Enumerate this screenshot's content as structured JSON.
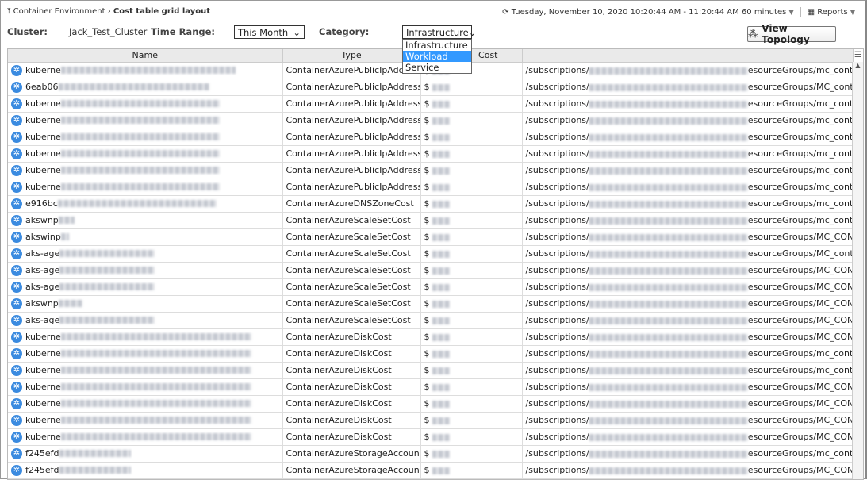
{
  "breadcrumb": {
    "parent": "Container Environment",
    "current": "Cost table grid layout"
  },
  "time_range_display": "Tuesday, November 10, 2020 10:20:44 AM - 11:20:44 AM 60 minutes",
  "reports_label": "Reports",
  "filters": {
    "cluster_label": "Cluster:",
    "cluster_value": "Jack_Test_Cluster",
    "time_label": "Time Range:",
    "time_value": "This Month",
    "category_label": "Category:",
    "category_value": "Infrastructure"
  },
  "category_options": [
    "Infrastructure",
    "Workload",
    "Service"
  ],
  "view_topology_label": "View Topology",
  "columns": [
    "Name",
    "Type",
    "Cost",
    ""
  ],
  "rows": [
    {
      "name": "kuberne",
      "type": "ContainerAzurePublicIpAddressCost",
      "cost": "$",
      "path_a": "/subscriptions/",
      "path_b": "esourceGroups/mc_containera"
    },
    {
      "name": "6eab06",
      "type": "ContainerAzurePublicIpAddressCost",
      "cost": "$",
      "path_a": "/subscriptions/",
      "path_b": "esourceGroups/MC_containera"
    },
    {
      "name": "kuberne",
      "type": "ContainerAzurePublicIpAddressCost",
      "cost": "$",
      "path_a": "/subscriptions/",
      "path_b": "esourceGroups/mc_containera"
    },
    {
      "name": "kuberne",
      "type": "ContainerAzurePublicIpAddressCost",
      "cost": "$",
      "path_a": "/subscriptions/",
      "path_b": "esourceGroups/mc_containera"
    },
    {
      "name": "kuberne",
      "type": "ContainerAzurePublicIpAddressCost",
      "cost": "$",
      "path_a": "/subscriptions/",
      "path_b": "esourceGroups/mc_containera"
    },
    {
      "name": "kuberne",
      "type": "ContainerAzurePublicIpAddressCost",
      "cost": "$",
      "path_a": "/subscriptions/",
      "path_b": "esourceGroups/mc_containera"
    },
    {
      "name": "kuberne",
      "type": "ContainerAzurePublicIpAddressCost",
      "cost": "$",
      "path_a": "/subscriptions/",
      "path_b": "esourceGroups/mc_containera"
    },
    {
      "name": "kuberne",
      "type": "ContainerAzurePublicIpAddressCost",
      "cost": "$",
      "path_a": "/subscriptions/",
      "path_b": "esourceGroups/mc_containera"
    },
    {
      "name": "e916bc",
      "type": "ContainerAzureDNSZoneCost",
      "cost": "$",
      "path_a": "/subscriptions/",
      "path_b": "esourceGroups/mc_containera"
    },
    {
      "name": "akswnp",
      "type": "ContainerAzureScaleSetCost",
      "cost": "$",
      "path_a": "/subscriptions/",
      "path_b": "esourceGroups/mc_containera"
    },
    {
      "name": "akswinp",
      "type": "ContainerAzureScaleSetCost",
      "cost": "$",
      "path_a": "/subscriptions/",
      "path_b": "esourceGroups/MC_CONTAINI"
    },
    {
      "name": "aks-age",
      "type": "ContainerAzureScaleSetCost",
      "cost": "$",
      "path_a": "/subscriptions/",
      "path_b": "esourceGroups/MC_containera"
    },
    {
      "name": "aks-age",
      "type": "ContainerAzureScaleSetCost",
      "cost": "$",
      "path_a": "/subscriptions/",
      "path_b": "esourceGroups/MC_CONTAINI"
    },
    {
      "name": "aks-age",
      "type": "ContainerAzureScaleSetCost",
      "cost": "$",
      "path_a": "/subscriptions/",
      "path_b": "esourceGroups/MC_CONTAINI"
    },
    {
      "name": "akswnp",
      "type": "ContainerAzureScaleSetCost",
      "cost": "$",
      "path_a": "/subscriptions/",
      "path_b": "esourceGroups/MC_CONTAINI"
    },
    {
      "name": "aks-age",
      "type": "ContainerAzureScaleSetCost",
      "cost": "$",
      "path_a": "/subscriptions/",
      "path_b": "esourceGroups/MC_CONTAINI"
    },
    {
      "name": "kuberne",
      "type": "ContainerAzureDiskCost",
      "cost": "$",
      "path_a": "/subscriptions/",
      "path_b": "esourceGroups/MC_CONTAINI"
    },
    {
      "name": "kuberne",
      "type": "ContainerAzureDiskCost",
      "cost": "$",
      "path_a": "/subscriptions/",
      "path_b": "esourceGroups/mc_containera"
    },
    {
      "name": "kuberne",
      "type": "ContainerAzureDiskCost",
      "cost": "$",
      "path_a": "/subscriptions/",
      "path_b": "esourceGroups/mc_containera"
    },
    {
      "name": "kuberne",
      "type": "ContainerAzureDiskCost",
      "cost": "$",
      "path_a": "/subscriptions/",
      "path_b": "esourceGroups/MC_CONTAINI"
    },
    {
      "name": "kuberne",
      "type": "ContainerAzureDiskCost",
      "cost": "$",
      "path_a": "/subscriptions/",
      "path_b": "esourceGroups/MC_CONTAINI"
    },
    {
      "name": "kuberne",
      "type": "ContainerAzureDiskCost",
      "cost": "$",
      "path_a": "/subscriptions/",
      "path_b": "esourceGroups/MC_CONTAINI"
    },
    {
      "name": "kuberne",
      "type": "ContainerAzureDiskCost",
      "cost": "$",
      "path_a": "/subscriptions/",
      "path_b": "esourceGroups/MC_CONTAINI"
    },
    {
      "name": "f245efd",
      "type": "ContainerAzureStorageAccountCost",
      "cost": "$",
      "path_a": "/subscriptions/",
      "path_b": "esourceGroups/mc_containera"
    },
    {
      "name": "f245efd",
      "type": "ContainerAzureStorageAccountCost",
      "cost": "$",
      "path_a": "/subscriptions/",
      "path_b": "esourceGroups/MC_CONTAINI"
    }
  ]
}
